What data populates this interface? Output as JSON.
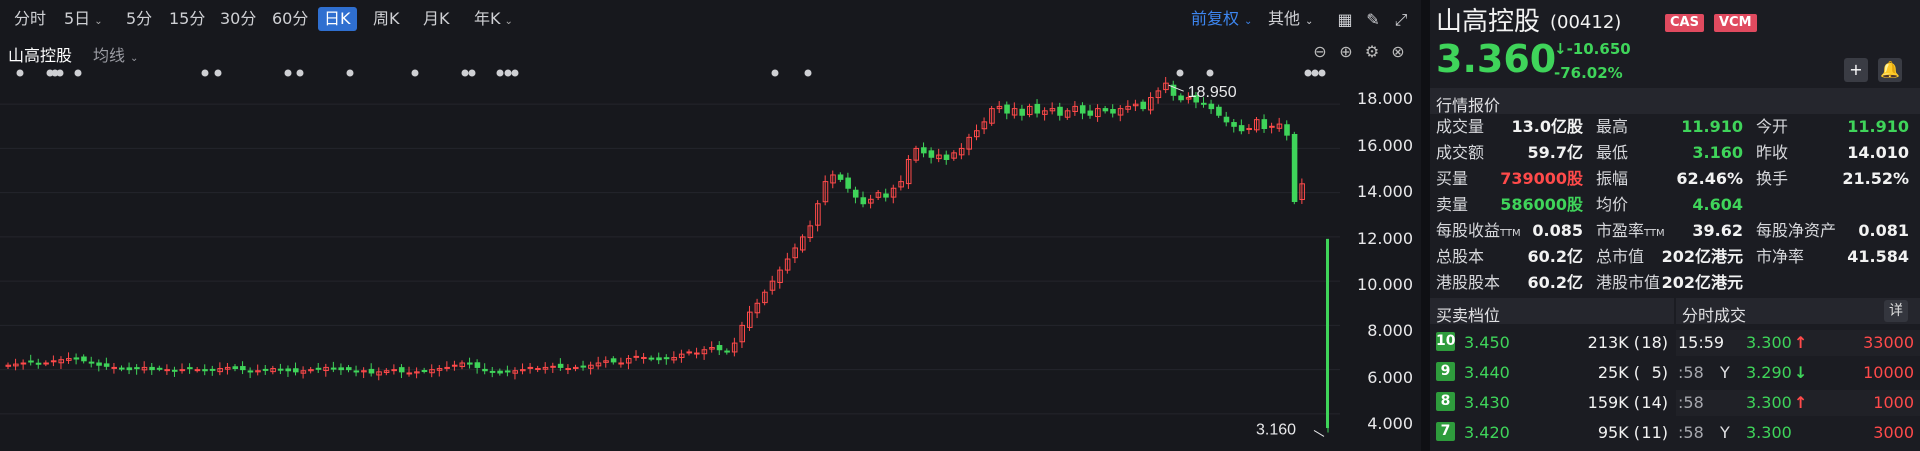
{
  "toolbar": {
    "periods": [
      "分时",
      "5日",
      "5分",
      "15分",
      "30分",
      "60分",
      "日K",
      "周K",
      "月K",
      "年K"
    ],
    "adjust": "前复权",
    "other": "其他"
  },
  "subbar": {
    "name": "山高控股",
    "indicator": "均线"
  },
  "chart": {
    "y_labels": [
      "18.000",
      "16.000",
      "14.000",
      "12.000",
      "10.000",
      "8.000",
      "6.000",
      "4.000"
    ],
    "high_label": "18.950",
    "low_label": "3.160"
  },
  "chart_data": {
    "type": "candlestick",
    "ylim": [
      3.0,
      19.5
    ],
    "closes": [
      6.2,
      6.25,
      6.3,
      6.35,
      6.28,
      6.3,
      6.4,
      6.45,
      6.5,
      6.48,
      6.4,
      6.3,
      6.2,
      6.15,
      6.1,
      6.05,
      6.0,
      6.05,
      6.1,
      6.0,
      6.05,
      6.0,
      5.95,
      6.0,
      6.05,
      6.0,
      5.95,
      6.0,
      6.05,
      6.1,
      6.05,
      6.0,
      5.9,
      5.95,
      6.0,
      6.05,
      6.0,
      5.95,
      5.9,
      5.95,
      6.0,
      6.05,
      6.1,
      6.05,
      6.0,
      6.0,
      5.9,
      5.95,
      5.85,
      5.9,
      5.95,
      6.0,
      5.9,
      5.85,
      5.9,
      5.95,
      6.0,
      6.05,
      6.1,
      6.2,
      6.3,
      6.25,
      6.1,
      5.95,
      5.9,
      5.85,
      5.9,
      5.95,
      6.0,
      6.1,
      6.05,
      6.1,
      6.15,
      6.1,
      6.05,
      6.1,
      6.15,
      6.2,
      6.3,
      6.4,
      6.35,
      6.3,
      6.5,
      6.6,
      6.55,
      6.5,
      6.45,
      6.5,
      6.55,
      6.7,
      6.8,
      6.75,
      6.9,
      7.0,
      6.9,
      6.8,
      7.2,
      8.0,
      8.6,
      9.0,
      9.5,
      10.0,
      10.5,
      11.0,
      11.5,
      12.0,
      12.5,
      13.5,
      14.5,
      14.8,
      14.6,
      14.2,
      13.8,
      13.5,
      13.7,
      14.0,
      13.8,
      14.2,
      14.5,
      15.5,
      16.0,
      15.8,
      15.6,
      15.7,
      15.5,
      15.8,
      16.0,
      16.5,
      16.8,
      17.2,
      17.8,
      17.9,
      17.6,
      17.8,
      17.5,
      17.9,
      17.6,
      17.7,
      17.8,
      17.5,
      17.7,
      17.9,
      17.6,
      17.5,
      17.8,
      17.7,
      17.6,
      17.8,
      17.9,
      18.0,
      17.8,
      18.3,
      18.6,
      18.95,
      18.4,
      18.2,
      18.3,
      18.1,
      18.0,
      17.8,
      17.5,
      17.2,
      17.0,
      16.8,
      16.9,
      17.3,
      16.9,
      17.0,
      17.1,
      16.6,
      13.6,
      14.4
    ],
    "last": {
      "high": 11.91,
      "low": 3.16,
      "open": 11.91,
      "close": 3.36
    }
  },
  "quote": {
    "name": "山高控股",
    "code": "(00412)",
    "badges": [
      "CAS",
      "VCM"
    ],
    "price": "3.360",
    "change": "-10.650",
    "pct": "-76.02%"
  },
  "market": {
    "title": "行情报价",
    "rows": [
      [
        [
          "成交量",
          "13.0亿股",
          "white"
        ],
        [
          "最高",
          "11.910",
          "green"
        ],
        [
          "今开",
          "11.910",
          "green"
        ]
      ],
      [
        [
          "成交额",
          "59.7亿",
          "white"
        ],
        [
          "最低",
          "3.160",
          "green"
        ],
        [
          "昨收",
          "14.010",
          "white"
        ]
      ],
      [
        [
          "买量",
          "739000股",
          "red"
        ],
        [
          "振幅",
          "62.46%",
          "white"
        ],
        [
          "换手",
          "21.52%",
          "white"
        ]
      ],
      [
        [
          "卖量",
          "586000股",
          "green"
        ],
        [
          "均价",
          "4.604",
          "green"
        ],
        [
          "",
          "",
          " "
        ]
      ],
      [
        [
          "每股收益",
          "0.085",
          "white"
        ],
        [
          "市盈率",
          "39.62",
          "white"
        ],
        [
          "每股净资产",
          "0.081",
          "white"
        ]
      ],
      [
        [
          "总股本",
          "60.2亿",
          "white"
        ],
        [
          "总市值",
          "202亿港元",
          "white"
        ],
        [
          "市净率",
          "41.584",
          "white"
        ]
      ],
      [
        [
          "港股股本",
          "60.2亿",
          "white"
        ],
        [
          "港股市值",
          "202亿港元",
          "white"
        ],
        [
          "",
          "",
          " "
        ]
      ]
    ],
    "ttm": "TTM"
  },
  "orderbook": {
    "title": "买卖档位",
    "rows": [
      {
        "lvl": "10",
        "price": "3.450",
        "vol": "213K (",
        "cnt": "18)"
      },
      {
        "lvl": "9",
        "price": "3.440",
        "vol": "25K (",
        "cnt": "5)"
      },
      {
        "lvl": "8",
        "price": "3.430",
        "vol": "159K (",
        "cnt": "14)"
      },
      {
        "lvl": "7",
        "price": "3.420",
        "vol": "95K (",
        "cnt": "11)"
      }
    ]
  },
  "trades": {
    "title": "分时成交",
    "detail": "详",
    "rows": [
      {
        "time": "15:59",
        "flag": "",
        "price": "3.300",
        "dir": "↑",
        "dircolor": "red",
        "vol": "33000"
      },
      {
        "time": ":58",
        "flag": "Y",
        "price": "3.290",
        "dir": "↓",
        "dircolor": "green",
        "vol": "10000"
      },
      {
        "time": ":58",
        "flag": "",
        "price": "3.300",
        "dir": "↑",
        "dircolor": "red",
        "vol": "1000"
      },
      {
        "time": ":58",
        "flag": "Y",
        "price": "3.300",
        "dir": "",
        "dircolor": "red",
        "vol": "3000"
      }
    ]
  },
  "colors": {
    "up": "#ff4a4a",
    "down": "#3fd45a",
    "accent": "#2f6fd0"
  }
}
